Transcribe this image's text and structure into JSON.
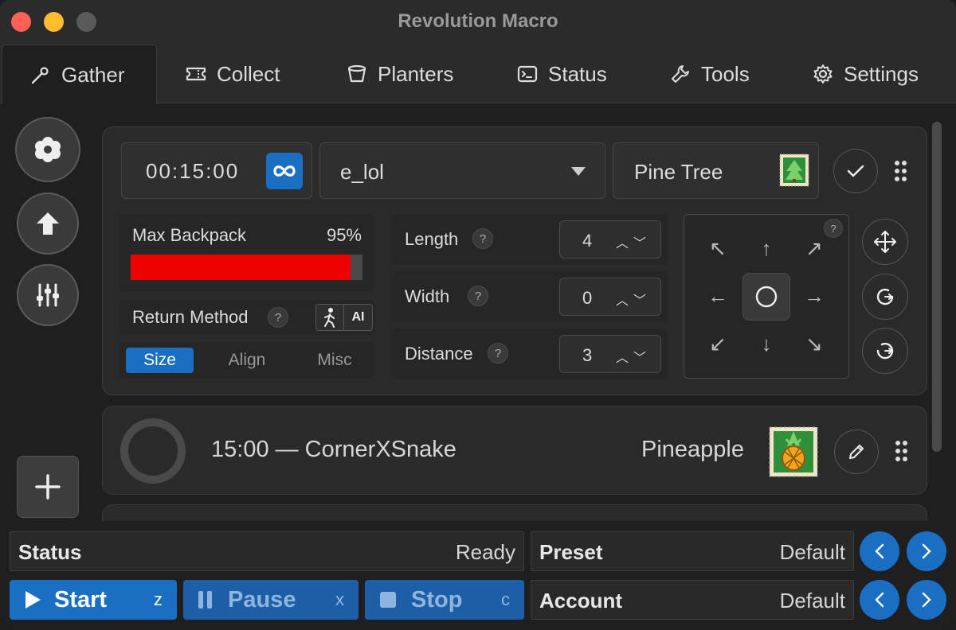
{
  "window": {
    "title": "Revolution Macro"
  },
  "tabs": [
    {
      "label": "Gather",
      "icon": "wand-icon"
    },
    {
      "label": "Collect",
      "icon": "ticket-icon"
    },
    {
      "label": "Planters",
      "icon": "pot-icon"
    },
    {
      "label": "Status",
      "icon": "terminal-icon"
    },
    {
      "label": "Tools",
      "icon": "wrench-icon"
    },
    {
      "label": "Settings",
      "icon": "gear-icon"
    }
  ],
  "gather": {
    "time": "00:15:00",
    "pattern": "e_lol",
    "field": "Pine Tree",
    "max_backpack": {
      "label": "Max Backpack",
      "value_text": "95%",
      "value": 95
    },
    "return_method": {
      "label": "Return Method",
      "option_ai": "AI"
    },
    "subtabs": [
      "Size",
      "Align",
      "Misc"
    ],
    "length": {
      "label": "Length",
      "value": "4"
    },
    "width": {
      "label": "Width",
      "value": "0"
    },
    "distance": {
      "label": "Distance",
      "value": "3"
    },
    "help": "?"
  },
  "entry": {
    "summary": "15:00 — CornerXSnake",
    "field": "Pineapple"
  },
  "status": {
    "key": "Status",
    "value": "Ready"
  },
  "preset": {
    "key": "Preset",
    "value": "Default"
  },
  "account": {
    "key": "Account",
    "value": "Default"
  },
  "controls": {
    "start": {
      "label": "Start",
      "key": "z"
    },
    "pause": {
      "label": "Pause",
      "key": "x"
    },
    "stop": {
      "label": "Stop",
      "key": "c"
    }
  },
  "colors": {
    "accent": "#1a6fc4",
    "backpack_fill": "#ee0000"
  }
}
